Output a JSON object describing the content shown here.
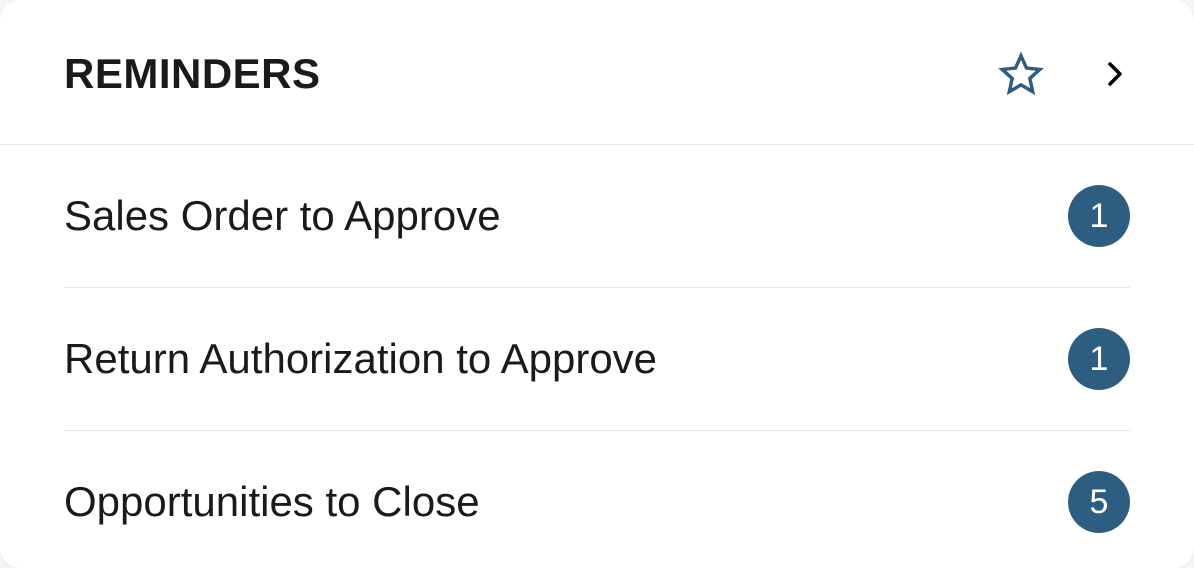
{
  "header": {
    "title": "REMINDERS"
  },
  "icons": {
    "star": "star-icon",
    "chevron": "chevron-right-icon"
  },
  "colors": {
    "badge_bg": "#2e5d82",
    "badge_fg": "#ffffff",
    "divider": "#e6e6e6",
    "text": "#1a1a1a",
    "star_stroke": "#2e5d82"
  },
  "reminders": [
    {
      "label": "Sales Order to Approve",
      "count": "1"
    },
    {
      "label": "Return Authorization to Approve",
      "count": "1"
    },
    {
      "label": "Opportunities to Close",
      "count": "5"
    }
  ]
}
